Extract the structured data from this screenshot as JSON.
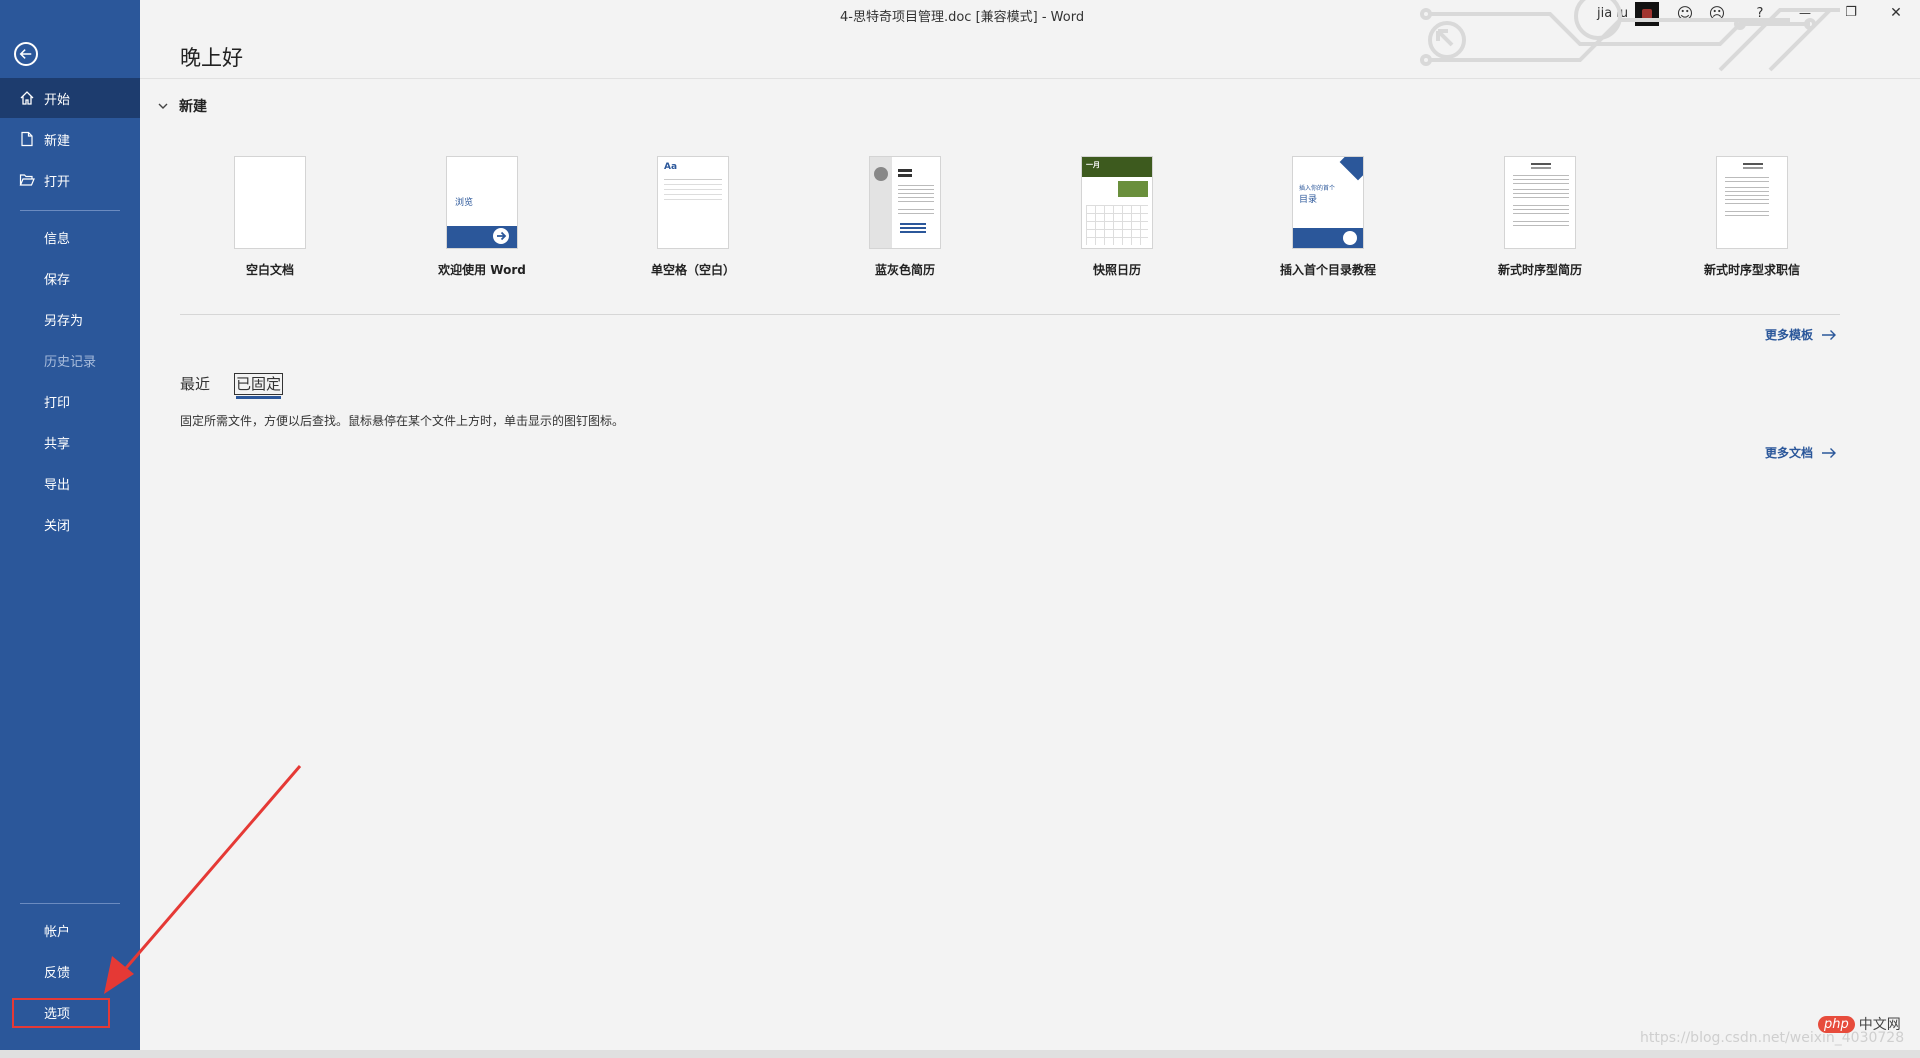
{
  "titlebar": {
    "document_title": "4-思特奇项目管理.doc [兼容模式]  -  Word",
    "user_name": "jia lu",
    "smile_glyph": "☺",
    "frown_glyph": "☹",
    "help_glyph": "?",
    "minimize_glyph": "—",
    "restore_glyph": "❐",
    "close_glyph": "✕"
  },
  "sidebar": {
    "back_icon": "arrow-left-icon",
    "items": [
      {
        "label": "开始",
        "icon": "home-icon"
      },
      {
        "label": "新建",
        "icon": "new-document-icon"
      },
      {
        "label": "打开",
        "icon": "open-folder-icon"
      },
      {
        "label": "信息"
      },
      {
        "label": "保存"
      },
      {
        "label": "另存为"
      },
      {
        "label": "历史记录"
      },
      {
        "label": "打印"
      },
      {
        "label": "共享"
      },
      {
        "label": "导出"
      },
      {
        "label": "关闭"
      }
    ],
    "bottom_items": [
      {
        "label": "帐户"
      },
      {
        "label": "反馈"
      },
      {
        "label": "选项"
      }
    ]
  },
  "main": {
    "greeting": "晚上好",
    "new_section_title": "新建",
    "templates": [
      {
        "label": "空白文档"
      },
      {
        "label": "欢迎使用 Word",
        "thumb_text": "浏览"
      },
      {
        "label": "单空格（空白）",
        "thumb_text": "Aa"
      },
      {
        "label": "蓝灰色简历"
      },
      {
        "label": "快照日历",
        "thumb_text": "一月"
      },
      {
        "label": "插入首个目录教程",
        "thumb_text": "目录",
        "thumb_sub": "插入你的首个"
      },
      {
        "label": "新式时序型简历"
      },
      {
        "label": "新式时序型求职信"
      }
    ],
    "more_templates": "更多模板",
    "tabs": [
      {
        "label": "最近"
      },
      {
        "label": "已固定"
      }
    ],
    "pin_hint": "固定所需文件，方便以后查找。鼠标悬停在某个文件上方时，单击显示的图钉图标。",
    "more_documents": "更多文档"
  },
  "overlay": {
    "watermark": "https://blog.csdn.net/weixin_4030728",
    "php_logo": "php",
    "php_text": "中文网"
  },
  "colors": {
    "sidebar": "#2b579a",
    "sidebar_active": "#1d3c6e",
    "accent": "#2b579a",
    "annotation": "#e53935"
  }
}
